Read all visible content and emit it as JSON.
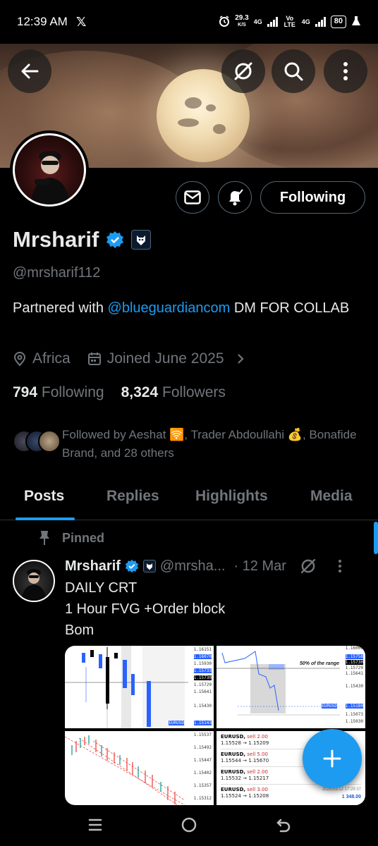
{
  "status_bar": {
    "time": "12:39 AM",
    "app_icon": "x-logo",
    "speed_value": "29.3",
    "speed_unit": "K/S",
    "net1": "4G",
    "net_volte": "Vo LTE",
    "net2": "4G",
    "battery": "80"
  },
  "header": {
    "back_icon": "arrow-left-icon",
    "grok_icon": "grok-icon",
    "search_icon": "search-icon",
    "more_icon": "more-vertical-icon"
  },
  "profile": {
    "name": "Mrsharif",
    "handle": "@mrsharif112",
    "bio_prefix": "Partnered with ",
    "bio_mention": "@blueguardiancom",
    "bio_suffix": "  DM FOR COLLAB",
    "location": "Africa",
    "joined": "Joined June 2025",
    "following_count": "794",
    "following_label": "Following",
    "followers_count": "8,324",
    "followers_label": "Followers",
    "followed_by": "Followed by Aeshat 🛜, Trader Abdoullahi 💰, Bonafide Brand, and 28 others",
    "follow_button": "Following"
  },
  "tabs": [
    {
      "label": "Posts",
      "active": true
    },
    {
      "label": "Replies",
      "active": false
    },
    {
      "label": "Highlights",
      "active": false
    },
    {
      "label": "Media",
      "active": false
    }
  ],
  "post": {
    "pinned_label": "Pinned",
    "author": "Mrsharif",
    "handle": "@mrsha...",
    "date": "· 12 Mar",
    "line1": "DAILY CRT",
    "line2": "1 Hour FVG +Order block",
    "line3": "Bom"
  },
  "media": {
    "img1_prices": [
      "1.16151",
      "1.16070",
      "1.15930",
      "1.15830",
      "1.15733",
      "1.15730",
      "1.15729",
      "1.15641",
      "1.15430",
      "1.15143"
    ],
    "img1_symbol": "EURUSD",
    "img2_prices": [
      "1.16000",
      "1.15758",
      "1.15730",
      "1.15729",
      "1.15641",
      "1.15430",
      "1.15180",
      "1.15073",
      "1.15030"
    ],
    "img2_note": "50% of the range",
    "img2_symbol": "EURUSD",
    "img3_prices": [
      "1.15537",
      "1.15492",
      "1.15447",
      "1.15402",
      "1.15357",
      "1.15312"
    ],
    "img4_trades": [
      {
        "sym": "EURUSD,",
        "side": "sell 2.00",
        "prices": "1.15528 → 1.15209"
      },
      {
        "sym": "EURUSD,",
        "side": "sell 5.00",
        "prices": "1.15544 → 1.15670"
      },
      {
        "sym": "EURUSD,",
        "side": "sell 2.00",
        "prices": "1.15532 → 1.15217"
      },
      {
        "sym": "EURUSD,",
        "side": "sell 3.00",
        "prices": "1.15524 → 1.15208"
      }
    ],
    "img4_time": "2025.03.12 17:29:37",
    "img4_profit": "1 348.00"
  },
  "colors": {
    "accent": "#1d9bf0",
    "background": "#000000",
    "muted": "#71767b",
    "text": "#e7e9ea"
  }
}
